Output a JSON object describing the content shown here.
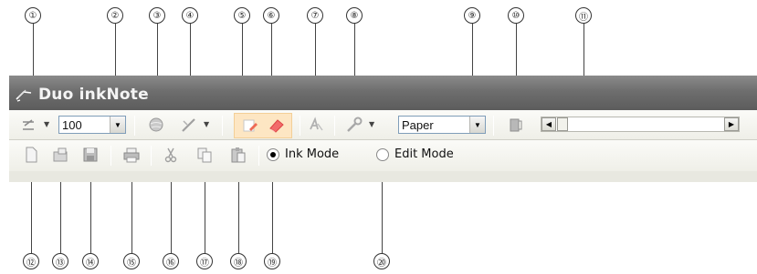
{
  "window": {
    "title": "Duo inkNote"
  },
  "toolbar1": {
    "zoom_value": "100",
    "paper_value": "Paper"
  },
  "toolbar2": {
    "ink_mode_label": "Ink Mode",
    "edit_mode_label": "Edit Mode",
    "selected_mode": "Ink Mode"
  },
  "callouts": {
    "top": [
      "①",
      "②",
      "③",
      "④",
      "⑤",
      "⑥",
      "⑦",
      "⑧",
      "⑨",
      "⑩",
      "⑪"
    ],
    "bottom": [
      "⑫",
      "⑬",
      "⑭",
      "⑮",
      "⑯",
      "⑰",
      "⑱",
      "⑲",
      "⑳"
    ]
  },
  "icons": {
    "pen": "pen-icon",
    "eraser_tool": "eraser-tool-icon",
    "eraser": "eraser-icon"
  }
}
